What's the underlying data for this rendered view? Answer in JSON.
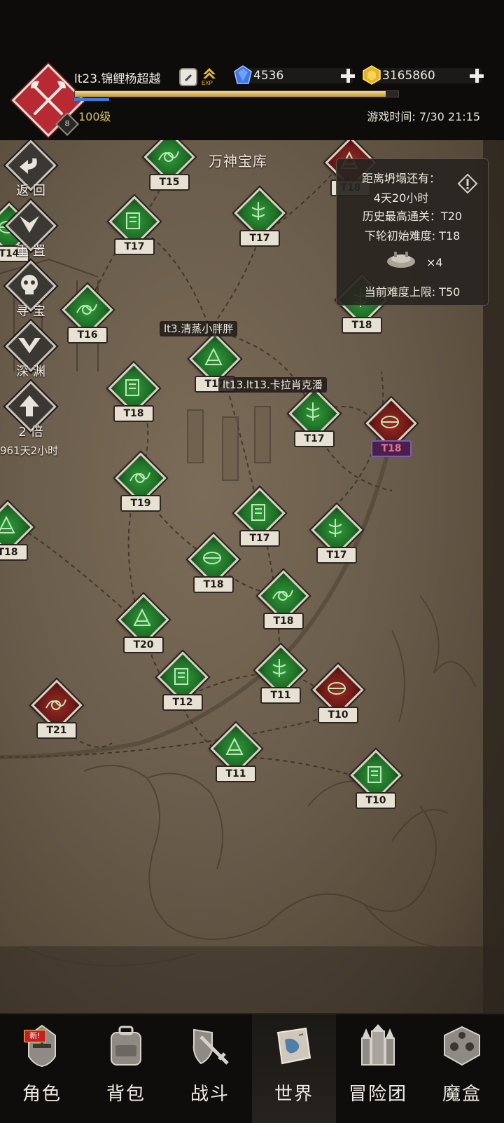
{
  "player": {
    "name": "lt23.锦鲤杨超越",
    "exp_icon": "EXP",
    "level_text": "100级",
    "badge_level": "8",
    "exp_progress": 0.96
  },
  "resources": {
    "gems": "4536",
    "gold": "3165860"
  },
  "game_time": "游戏时间: 7/30 21:15",
  "map": {
    "title": "万神宝库",
    "team_labels": [
      "lt3.清蒸小胖胖",
      "lt13.lt13.卡拉肖克潘"
    ],
    "nodes": [
      {
        "tier": "T15",
        "color": "green"
      },
      {
        "tier": "T18",
        "color": "red"
      },
      {
        "tier": "T17",
        "color": "green"
      },
      {
        "tier": "T17",
        "color": "green"
      },
      {
        "tier": "T14",
        "color": "green"
      },
      {
        "tier": "T16",
        "color": "green"
      },
      {
        "tier": "T17",
        "color": "green"
      },
      {
        "tier": "T18",
        "color": "green"
      },
      {
        "tier": "T17",
        "color": "green"
      },
      {
        "tier": "T18",
        "color": "red"
      },
      {
        "tier": "T19",
        "color": "green"
      },
      {
        "tier": "T18",
        "color": "green"
      },
      {
        "tier": "T17",
        "color": "green"
      },
      {
        "tier": "T17",
        "color": "green"
      },
      {
        "tier": "T18",
        "color": "green"
      },
      {
        "tier": "T18",
        "color": "green"
      },
      {
        "tier": "T20",
        "color": "green"
      },
      {
        "tier": "T12",
        "color": "green"
      },
      {
        "tier": "T11",
        "color": "green"
      },
      {
        "tier": "T10",
        "color": "red"
      },
      {
        "tier": "T21",
        "color": "red"
      },
      {
        "tier": "T11",
        "color": "green"
      },
      {
        "tier": "T10",
        "color": "green"
      },
      {
        "tier": "T18",
        "color": "green"
      }
    ]
  },
  "side_menu": {
    "back": "返 回",
    "reset": "重 置",
    "treasure": "寻 宝",
    "abyss": "深 渊",
    "multiplier": "2 倍",
    "multiplier_timer": "961天2小时"
  },
  "info_panel": {
    "collapse_label": "距离坍塌还有：",
    "collapse_time": "4天20小时",
    "best_clear": "历史最高通关：T20",
    "next_start": "下轮初始难度: T18",
    "ticket_count": "×4",
    "difficulty_cap": "当前难度上限: T50"
  },
  "bottom_nav": {
    "new_badge": "新!",
    "tabs": [
      "角色",
      "背包",
      "战斗",
      "世界",
      "冒险团",
      "魔盒"
    ],
    "active": "世界"
  }
}
